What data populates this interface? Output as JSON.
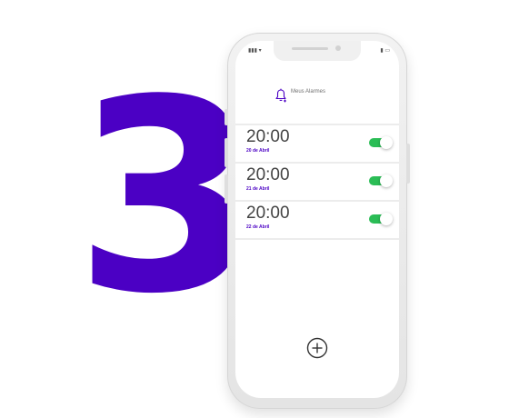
{
  "step_number": "3",
  "accent_color": "#4b00c4",
  "toggle_color": "#2bbd56",
  "status_bar": {
    "left": "▮▮▮ ▾",
    "right": "▮ ▭"
  },
  "header": {
    "icon": "bell-add-icon",
    "title": "Meus Alarmes"
  },
  "alarms": [
    {
      "time": "20:00",
      "date": "20 de Abril",
      "enabled": true
    },
    {
      "time": "20:00",
      "date": "21 de Abril",
      "enabled": true
    },
    {
      "time": "20:00",
      "date": "22 de Abril",
      "enabled": true
    }
  ],
  "add_button": {
    "icon": "plus-circle-icon"
  }
}
